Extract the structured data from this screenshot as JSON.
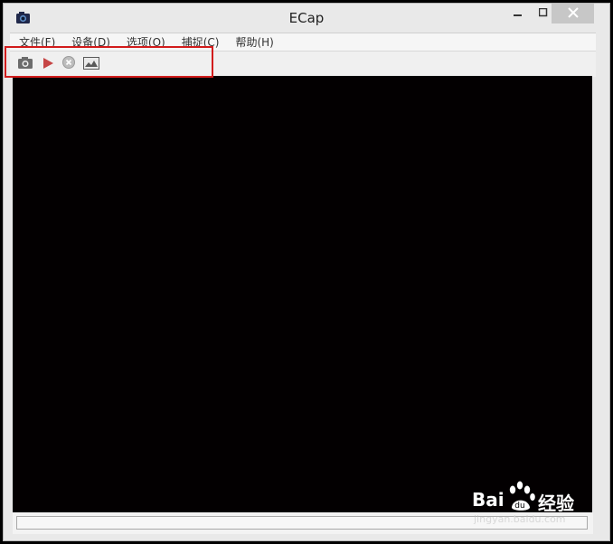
{
  "window": {
    "title": "ECap",
    "app_icon": "camera-icon",
    "controls": {
      "minimize_icon": "minimize-icon",
      "maximize_icon": "maximize-icon",
      "close_icon": "close-icon"
    }
  },
  "menubar": {
    "items": [
      {
        "label": "文件(F)"
      },
      {
        "label": "设备(D)"
      },
      {
        "label": "选项(O)"
      },
      {
        "label": "捕捉(C)"
      },
      {
        "label": "帮助(H)"
      }
    ]
  },
  "toolbar": {
    "tools": [
      {
        "icon": "camera-icon"
      },
      {
        "icon": "play-icon"
      },
      {
        "icon": "stop-icon"
      },
      {
        "icon": "image-icon"
      }
    ],
    "highlight_color": "#d21c1c"
  },
  "statusbar": {
    "text": ""
  },
  "watermark": {
    "brand": "Bai",
    "brand_tail": "经验",
    "url": "jingyan.baidu.com"
  }
}
